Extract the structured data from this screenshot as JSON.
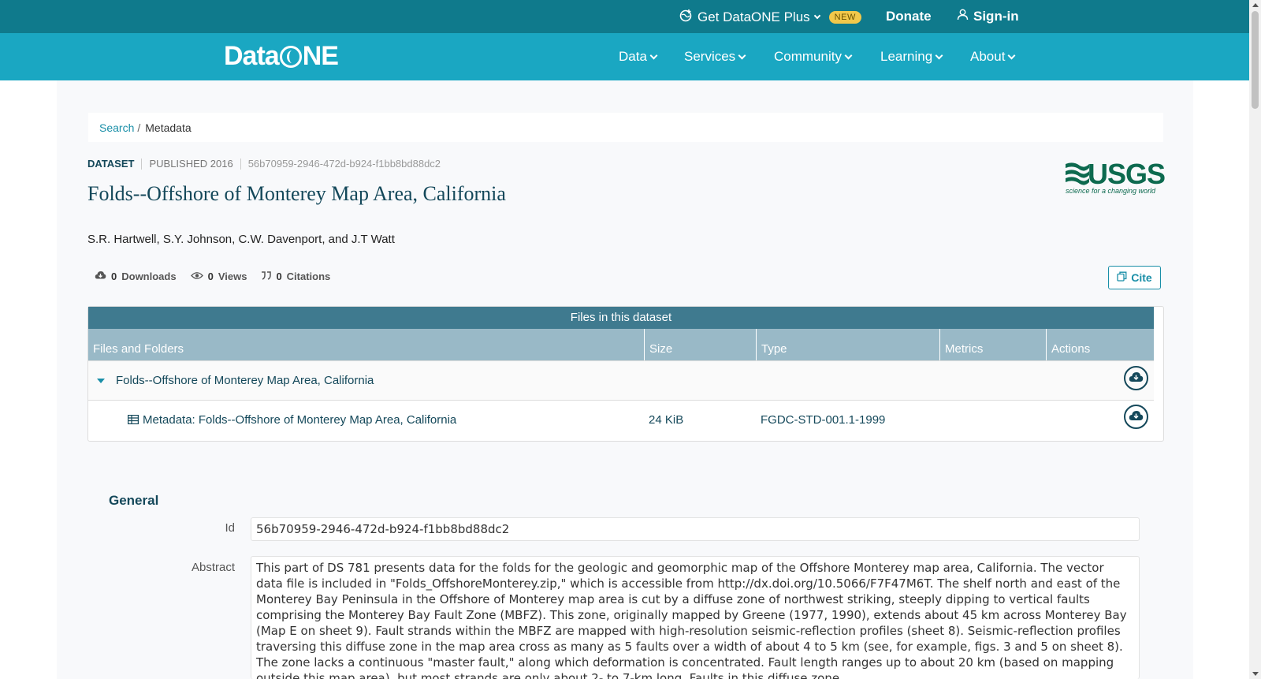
{
  "topbar": {
    "plus_label": "Get DataONE Plus",
    "new_badge": "NEW",
    "donate_label": "Donate",
    "signin_label": "Sign-in"
  },
  "nav": {
    "logo": "DataONE",
    "items": [
      {
        "label": "Data"
      },
      {
        "label": "Services"
      },
      {
        "label": "Community"
      },
      {
        "label": "Learning"
      },
      {
        "label": "About"
      }
    ]
  },
  "breadcrumb": {
    "search": "Search",
    "sep": "/",
    "current": "Metadata"
  },
  "dataset": {
    "type": "DATASET",
    "published": "PUBLISHED 2016",
    "pid": "56b70959-2946-472d-b924-f1bb8bd88dc2",
    "title": "Folds--Offshore of Monterey Map Area, California",
    "authors": "S.R. Hartwell, S.Y. Johnson, C.W. Davenport, and J.T Watt"
  },
  "logo_usgs": {
    "word": "USGS",
    "tagline": "science for a changing world"
  },
  "stats": {
    "downloads_count": "0",
    "downloads_label": "Downloads",
    "views_count": "0",
    "views_label": "Views",
    "citations_count": "0",
    "citations_label": "Citations"
  },
  "cite_label": "Cite",
  "files": {
    "heading": "Files in this dataset",
    "columns": [
      "Files and Folders",
      "Size",
      "Type",
      "Metrics",
      "Actions"
    ],
    "rows": [
      {
        "name": "Folds--Offshore of Monterey Map Area, California",
        "size": "",
        "type": ""
      },
      {
        "name": "Metadata: Folds--Offshore of Monterey Map Area, California",
        "size": "24 KiB",
        "type": "FGDC-STD-001.1-1999"
      }
    ]
  },
  "general": {
    "title": "General",
    "id_label": "Id",
    "id_value": "56b70959-2946-472d-b924-f1bb8bd88dc2",
    "abstract_label": "Abstract",
    "abstract_value": "This part of DS 781 presents data for the folds for the geologic and geomorphic map of the Offshore Monterey map area, California. The vector data file is included in \"Folds_OffshoreMonterey.zip,\" which is accessible from http://dx.doi.org/10.5066/F7F47M6T. The shelf north and east of the Monterey Bay Peninsula in the Offshore of Monterey map area is cut by a diffuse zone of northwest striking, steeply dipping to vertical faults comprising the Monterey Bay Fault Zone (MBFZ). This zone, originally mapped by Greene (1977, 1990), extends about 45 km across Monterey Bay (Map E on sheet 9). Fault strands within the MBFZ are mapped with high-resolution seismic-reflection profiles (sheet 8). Seismic-reflection profiles traversing this diffuse zone in the map area cross as many as 5 faults over a width of about 4 to 5 km (see, for example, figs. 3 and 5 on sheet 8). The zone lacks a continuous \"master fault,\" along which deformation is concentrated. Fault length ranges up to about 20 km (based on mapping outside this map area), but most strands are only about 2- to 7-km long. Faults in this diffuse zone"
  }
}
